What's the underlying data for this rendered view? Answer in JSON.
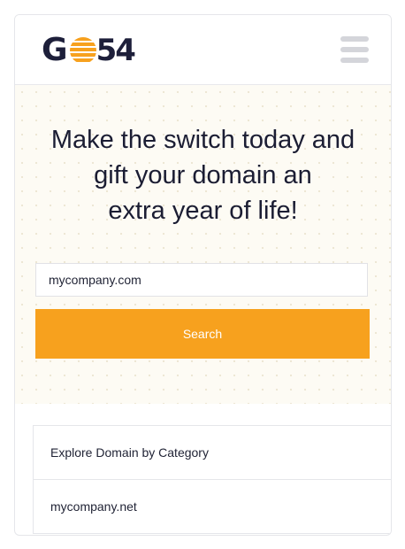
{
  "header": {
    "logo": {
      "prefix": "G",
      "number": "54"
    },
    "menu_icon": "hamburger-menu-icon"
  },
  "hero": {
    "headline_lines": [
      "Make the switch today and",
      "gift your domain an",
      "extra year of life!"
    ]
  },
  "search": {
    "value": "mycompany.com",
    "button_label": "Search"
  },
  "list": {
    "items": [
      {
        "label": "Explore Domain by Category"
      },
      {
        "label": "mycompany.net"
      }
    ]
  },
  "colors": {
    "accent": "#f7a11e",
    "brand_dark": "#1d1f3a",
    "hero_bg": "#fdfbf4"
  }
}
